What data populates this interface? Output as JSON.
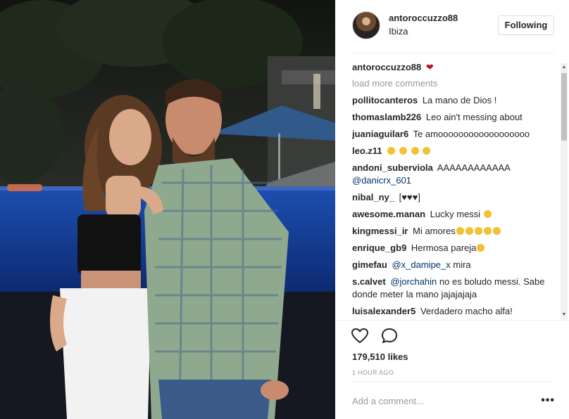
{
  "post": {
    "username": "antoroccuzzo88",
    "location": "Ibiza",
    "follow_label": "Following"
  },
  "caption": {
    "username": "antoroccuzzo88"
  },
  "load_more": "load more comments",
  "comments": [
    {
      "user": "pollitocanteros",
      "text": "La mano de Dios !"
    },
    {
      "user": "thomaslamb226",
      "text": "Leo ain't messing about"
    },
    {
      "user": "juaniaguilar6",
      "text": "Te amoooooooooooooooooo"
    },
    {
      "user": "leo.z11",
      "text": ""
    },
    {
      "user": "andoni_suberviola",
      "text": "AAAAAAAAAAAA",
      "mention": "@danicrx_601"
    },
    {
      "user": "nibal_ny_",
      "text": "[♥♥♥]"
    },
    {
      "user": "awesome.manan",
      "text": "Lucky messi"
    },
    {
      "user": "kingmessi_ir",
      "text": "Mi amores"
    },
    {
      "user": "enrique_gb9",
      "text": "Hermosa pareja"
    },
    {
      "user": "gimefau",
      "mention": "@x_damipe_x",
      "text": "mira"
    },
    {
      "user": "s.calvet",
      "mention": "@jorchahin",
      "text": "no es boludo messi. Sabe donde meter la mano jajajajaja"
    },
    {
      "user": "luisalexander5",
      "text": "Verdadero macho alfa!"
    }
  ],
  "likes": "179,510 likes",
  "time_ago": "1 HOUR AGO",
  "add_comment_placeholder": "Add a comment...",
  "more_label": "•••",
  "icons": {
    "like": "heart-outline-icon",
    "comment": "speech-bubble-icon",
    "more": "ellipsis-icon"
  },
  "colors": {
    "heart": "#b0142a",
    "mention": "#003569",
    "muted": "#999999"
  }
}
